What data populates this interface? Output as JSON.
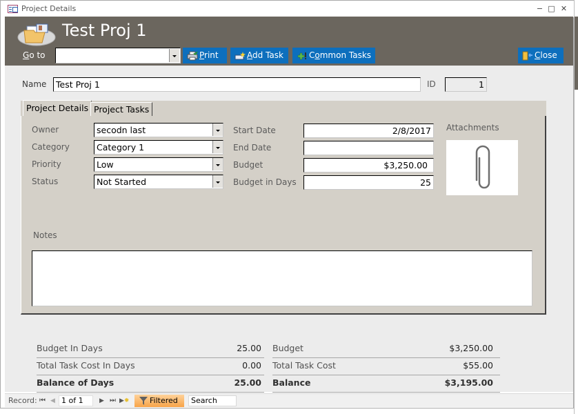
{
  "window": {
    "title": "Project Details",
    "controls": {
      "minimize": "−",
      "restore": "□",
      "close": "✕"
    }
  },
  "header": {
    "title": "Test Proj 1",
    "goto_label_accel": "G",
    "goto_label_rest": "o to",
    "goto_value": "",
    "buttons": {
      "print": {
        "accel": "P",
        "rest": "rint",
        "icon": "printer-icon"
      },
      "add_task": {
        "accel": "A",
        "rest": "dd Task",
        "icon": "add-task-icon"
      },
      "common_tasks": {
        "pre": "C",
        "accel": "o",
        "rest": "mmon Tasks",
        "icon": "common-tasks-icon"
      },
      "close": {
        "accel": "C",
        "rest": "lose",
        "icon": "exit-door-icon"
      }
    },
    "colors": {
      "band": "#6b665e",
      "button": "#0d6fbd"
    }
  },
  "form": {
    "name_label": "Name",
    "name_value": "Test Proj 1",
    "id_label": "ID",
    "id_value": "1"
  },
  "tabs": [
    {
      "label": "Project Details",
      "selected": true
    },
    {
      "label": "Project Tasks",
      "selected": false
    }
  ],
  "details": {
    "owner_label": "Owner",
    "owner_value": "secodn last",
    "category_label": "Category",
    "category_value": "Category 1",
    "priority_label": "Priority",
    "priority_value": "Low",
    "status_label": "Status",
    "status_value": "Not Started",
    "start_date_label": "Start Date",
    "start_date_value": "2/8/2017",
    "end_date_label": "End Date",
    "end_date_value": "",
    "budget_label": "Budget",
    "budget_value": "$3,250.00",
    "budget_days_label": "Budget in Days",
    "budget_days_value": "25",
    "attachments_label": "Attachments",
    "notes_label": "Notes",
    "notes_value": ""
  },
  "summary": {
    "days": [
      {
        "label": "Budget In Days",
        "value": "25.00"
      },
      {
        "label": "Total Task Cost In Days",
        "value": "0.00"
      },
      {
        "label": "Balance of Days",
        "value": "25.00"
      }
    ],
    "money": [
      {
        "label": "Budget",
        "value": "$3,250.00"
      },
      {
        "label": "Total Task Cost",
        "value": "$55.00"
      },
      {
        "label": "Balance",
        "value": "$3,195.00"
      }
    ]
  },
  "navbar": {
    "record_label": "Record:",
    "record_position": "1 of 1",
    "filter_label": "Filtered",
    "search_placeholder": "Search"
  }
}
